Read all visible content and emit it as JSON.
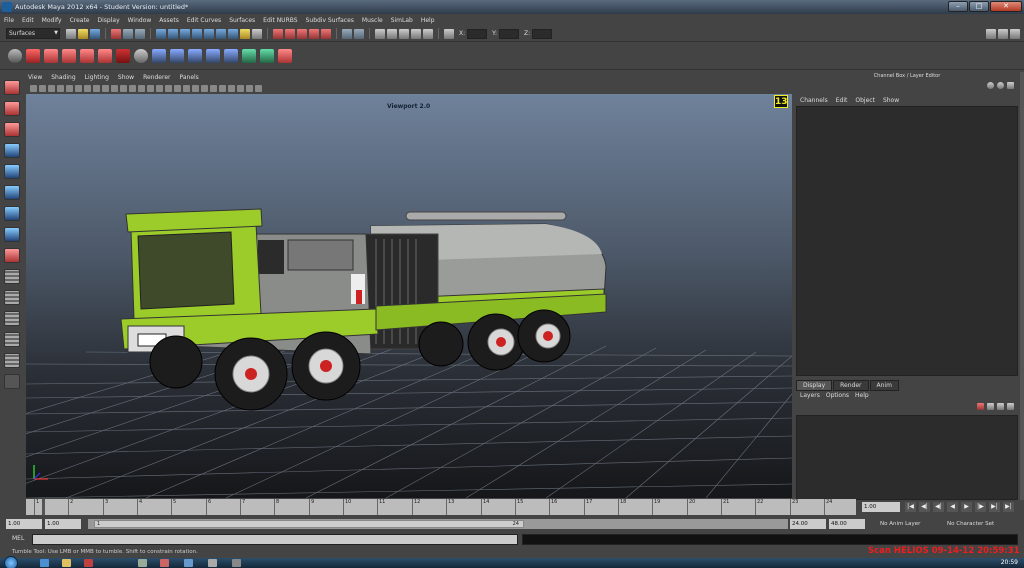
{
  "window": {
    "title": "Autodesk Maya 2012 x64 - Student Version: untitled*",
    "buttons": [
      "–",
      "□",
      "✕"
    ]
  },
  "menubar": [
    "File",
    "Edit",
    "Modify",
    "Create",
    "Display",
    "Window",
    "Assets",
    "Edit Curves",
    "Surfaces",
    "Edit NURBS",
    "Subdiv Surfaces",
    "Muscle",
    "SimLab",
    "Help"
  ],
  "statusline": {
    "menuset": "Surfaces",
    "coord_labels": [
      "X:",
      "Y:",
      "Z:"
    ]
  },
  "panel": {
    "menus": [
      "View",
      "Shading",
      "Lighting",
      "Show",
      "Renderer",
      "Panels"
    ],
    "viewport_title": "Viewport 2.0",
    "badge": "13"
  },
  "channelbox": {
    "title": "Channel Box / Layer Editor",
    "menus": [
      "Channels",
      "Edit",
      "Object",
      "Show"
    ],
    "layer_tabs": [
      "Display",
      "Render",
      "Anim"
    ],
    "layer_menus": [
      "Layers",
      "Options",
      "Help"
    ]
  },
  "timeslider": {
    "ticks": [
      "1",
      "2",
      "3",
      "4",
      "5",
      "6",
      "7",
      "8",
      "9",
      "10",
      "11",
      "12",
      "13",
      "14",
      "15",
      "16",
      "17",
      "18",
      "19",
      "20",
      "21",
      "22",
      "23",
      "24"
    ],
    "current_time": "1.00",
    "controls": [
      "|◀",
      "◀|",
      "◀|",
      "◀",
      "▶",
      "|▶",
      "▶|",
      "▶|"
    ]
  },
  "range": {
    "start_time": "1.00",
    "playback_start": "1.00",
    "range_start_label": "1",
    "range_end_label": "24",
    "playback_end": "24.00",
    "end_time": "48.00",
    "anim_layer": "No Anim Layer",
    "character_set": "No Character Set"
  },
  "commandline": {
    "label": "MEL"
  },
  "helpline": {
    "text": "Tumble Tool: Use LMB or MMB to tumble. Shift to constrain rotation."
  },
  "watermark": "Scan HELIOS 09-14-12 20:59:31",
  "taskbar": {
    "clock": "20:59"
  }
}
